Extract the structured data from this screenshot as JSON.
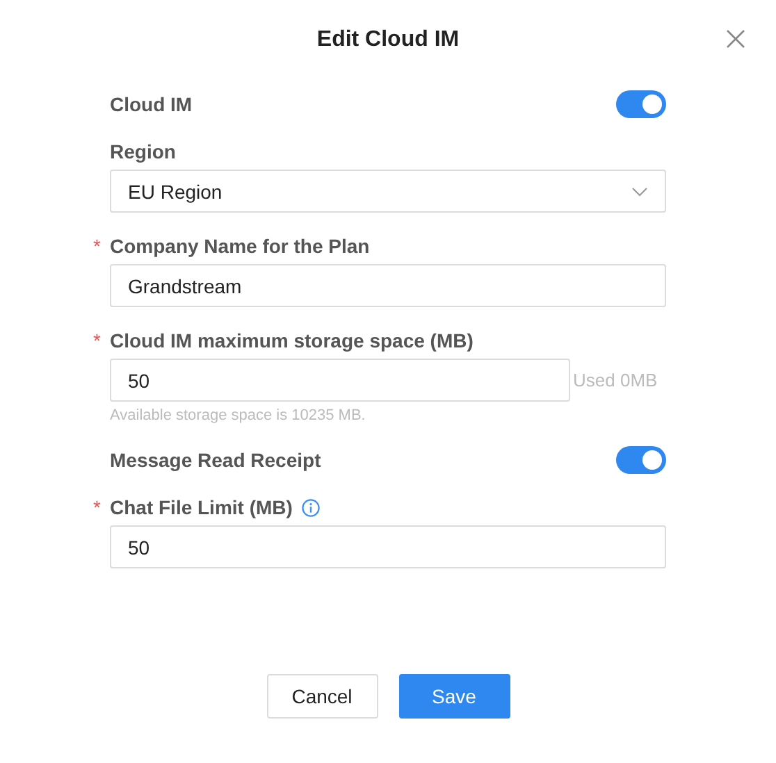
{
  "dialog": {
    "title": "Edit Cloud IM"
  },
  "fields": [
    {
      "kind": "toggle",
      "label": "Cloud IM",
      "on": true
    },
    {
      "kind": "select",
      "label": "Region",
      "value": "EU Region"
    },
    {
      "kind": "input",
      "required_mark": "*",
      "label": "Company Name for the Plan",
      "value": "Grandstream"
    },
    {
      "kind": "input",
      "required_mark": "*",
      "label": "Cloud IM maximum storage space (MB)",
      "value": "50",
      "suffix": "Used 0MB",
      "help": "Available storage space is 10235 MB."
    },
    {
      "kind": "toggle",
      "label": "Message Read Receipt",
      "on": true
    },
    {
      "kind": "input",
      "required_mark": "*",
      "label": "Chat File Limit (MB)",
      "info": true,
      "value": "50"
    }
  ],
  "buttons": [
    {
      "label": "Cancel",
      "kind": "secondary"
    },
    {
      "label": "Save",
      "kind": "primary"
    }
  ]
}
